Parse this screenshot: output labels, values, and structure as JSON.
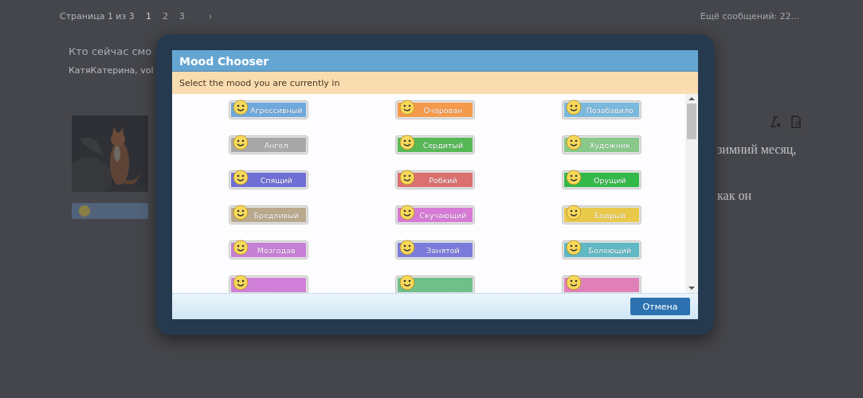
{
  "page": {
    "pagination": {
      "label": "Страница 1 из 3",
      "pages": [
        {
          "label": "1",
          "selected": true
        },
        {
          "label": "2",
          "selected": false
        },
        {
          "label": "3",
          "selected": false
        }
      ],
      "next": "›"
    },
    "more_posts": "Ещё сообщений: 22...",
    "who_online": {
      "title": "Кто сейчас смо",
      "names": "КатяКатерина, vol"
    },
    "post": {
      "mood_badge": {
        "color": "#51637a"
      },
      "text_lines": [
        "зимний месяц,",
        "как он"
      ]
    }
  },
  "dialog": {
    "title": "Mood Chooser",
    "subtitle": "Select the mood you are currently in",
    "moods": [
      {
        "label": "Агрессивный",
        "color": "#6fa8dc"
      },
      {
        "label": "Очарован",
        "color": "#f59a4a"
      },
      {
        "label": "Позабавило",
        "color": "#7ab9dd"
      },
      {
        "label": "Ангел",
        "color": "#a8a8a8"
      },
      {
        "label": "Сердитый",
        "color": "#56b956"
      },
      {
        "label": "Художник",
        "color": "#88c98a"
      },
      {
        "label": "Спящий",
        "color": "#6f6fd6"
      },
      {
        "label": "Робкий",
        "color": "#db7070"
      },
      {
        "label": "Орущий",
        "color": "#33b94a"
      },
      {
        "label": "Бредливый",
        "color": "#b9a88c"
      },
      {
        "label": "Скучающий",
        "color": "#d67ad6"
      },
      {
        "label": "Бодрый",
        "color": "#e8c94a"
      },
      {
        "label": "Мозгодав",
        "color": "#c77fd6"
      },
      {
        "label": "Занятой",
        "color": "#7b7bdc"
      },
      {
        "label": "Болеющий",
        "color": "#5fb8c4"
      },
      {
        "color": "#d080d8"
      },
      {
        "color": "#6fbf8a"
      },
      {
        "color": "#e080b8"
      }
    ],
    "cancel_button": "Отмена"
  }
}
